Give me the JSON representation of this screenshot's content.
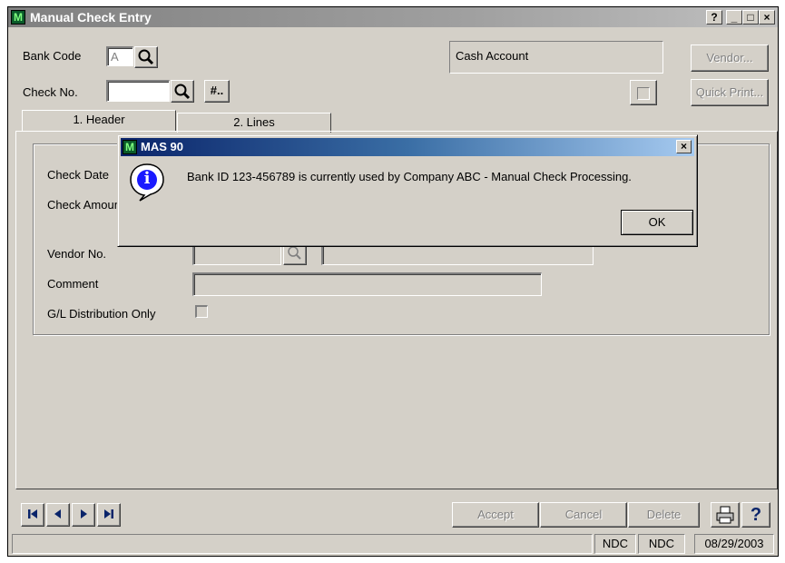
{
  "window": {
    "title": "Manual Check Entry",
    "icon_letter": "M",
    "help_btn": "?",
    "min_btn": "_",
    "max_btn": "□",
    "close_btn": "×"
  },
  "form": {
    "bank_code_label": "Bank Code",
    "bank_code_value": "A",
    "check_no_label": "Check No.",
    "check_no_value": "",
    "next_check_btn": "#..",
    "cash_account": "Cash Account",
    "vendor_btn": "Vendor...",
    "quick_print_btn": "Quick Print..."
  },
  "tabs": [
    {
      "label": "1. Header"
    },
    {
      "label": "2. Lines"
    }
  ],
  "header_panel": {
    "check_date_label": "Check Date",
    "check_amount_label": "Check Amount",
    "vendor_no_label": "Vendor No.",
    "comment_label": "Comment",
    "gl_dist_label": "G/L Distribution Only"
  },
  "dialog": {
    "title": "MAS 90",
    "icon_letter": "M",
    "close_btn": "×",
    "info_glyph": "i",
    "message": "Bank ID 123-456789 is currently used by Company ABC - Manual Check Processing.",
    "ok_label": "OK"
  },
  "footer": {
    "nav_first": "first",
    "nav_prev": "prev",
    "nav_next": "next",
    "nav_last": "last",
    "accept_label": "Accept",
    "cancel_label": "Cancel",
    "delete_label": "Delete",
    "help_label": "?"
  },
  "status_bar": {
    "message": "",
    "cell1": "NDC",
    "cell2": "NDC",
    "date": "08/29/2003"
  }
}
